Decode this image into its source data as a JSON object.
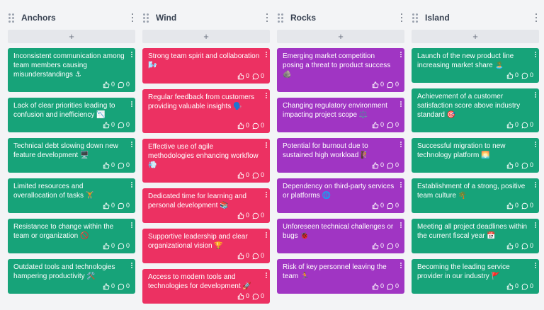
{
  "colors": {
    "green": "#17a379",
    "red": "#ec3162",
    "purple": "#a035c3"
  },
  "columns": [
    {
      "title": "Anchors",
      "add_label": "+",
      "color": "#17a379",
      "cards": [
        {
          "text": "Inconsistent communication among team members causing misunderstandings ⚓",
          "likes": "0",
          "comments": "0",
          "h": 62
        },
        {
          "text": "Lack of clear priorities leading to confusion and inefficiency 📉",
          "likes": "0",
          "comments": "0",
          "h": 49
        },
        {
          "text": "Technical debt slowing down new feature development 🖥️",
          "likes": "0",
          "comments": "0",
          "h": 49
        },
        {
          "text": "Limited resources and overallocation of tasks 🏋️",
          "likes": "0",
          "comments": "0",
          "h": 49
        },
        {
          "text": "Resistance to change within the team or organization 🚫",
          "likes": "0",
          "comments": "0",
          "h": 49
        },
        {
          "text": "Outdated tools and technologies hampering productivity 🛠️",
          "likes": "0",
          "comments": "0",
          "h": 49
        }
      ]
    },
    {
      "title": "Wind",
      "add_label": "+",
      "color": "#ec3162",
      "cards": [
        {
          "text": "Strong team spirit and collaboration 🌬️",
          "likes": "0",
          "comments": "0",
          "h": 50
        },
        {
          "text": "Regular feedback from customers providing valuable insights 🗣️",
          "likes": "0",
          "comments": "0",
          "h": 62
        },
        {
          "text": "Effective use of agile methodologies enhancing workflow 💨",
          "likes": "0",
          "comments": "0",
          "h": 62
        },
        {
          "text": "Dedicated time for learning and personal development 📚",
          "likes": "0",
          "comments": "0",
          "h": 49
        },
        {
          "text": "Supportive leadership and clear organizational vision 🏆",
          "likes": "0",
          "comments": "0",
          "h": 49
        },
        {
          "text": "Access to modern tools and technologies for development 🚀",
          "likes": "0",
          "comments": "0",
          "h": 49
        }
      ]
    },
    {
      "title": "Rocks",
      "add_label": "+",
      "color": "#a035c3",
      "cards": [
        {
          "text": "Emerging market competition posing a threat to product success 🪨",
          "likes": "0",
          "comments": "0",
          "h": 62
        },
        {
          "text": "Changing regulatory environment impacting project scope ⚖️",
          "likes": "0",
          "comments": "0",
          "h": 49
        },
        {
          "text": "Potential for burnout due to sustained high workload 🧗",
          "likes": "0",
          "comments": "0",
          "h": 49
        },
        {
          "text": "Dependency on third-party services or platforms 🌐",
          "likes": "0",
          "comments": "0",
          "h": 49
        },
        {
          "text": "Unforeseen technical challenges or bugs 🐞",
          "likes": "0",
          "comments": "0",
          "h": 49
        },
        {
          "text": "Risk of key personnel leaving the team 🏃",
          "likes": "0",
          "comments": "0",
          "h": 49
        }
      ]
    },
    {
      "title": "Island",
      "add_label": "+",
      "color": "#17a379",
      "cards": [
        {
          "text": "Launch of the new product line increasing market share 🏝️",
          "likes": "0",
          "comments": "0",
          "h": 49
        },
        {
          "text": "Achievement of a customer satisfaction score above industry standard 🎯",
          "likes": "0",
          "comments": "0",
          "h": 62
        },
        {
          "text": "Successful migration to new technology platform 🌅",
          "likes": "0",
          "comments": "0",
          "h": 49
        },
        {
          "text": "Establishment of a strong, positive team culture 🌴",
          "likes": "0",
          "comments": "0",
          "h": 49
        },
        {
          "text": "Meeting all project deadlines within the current fiscal year 📅",
          "likes": "0",
          "comments": "0",
          "h": 49
        },
        {
          "text": "Becoming the leading service provider in our industry 🚩",
          "likes": "0",
          "comments": "0",
          "h": 49
        }
      ]
    }
  ]
}
